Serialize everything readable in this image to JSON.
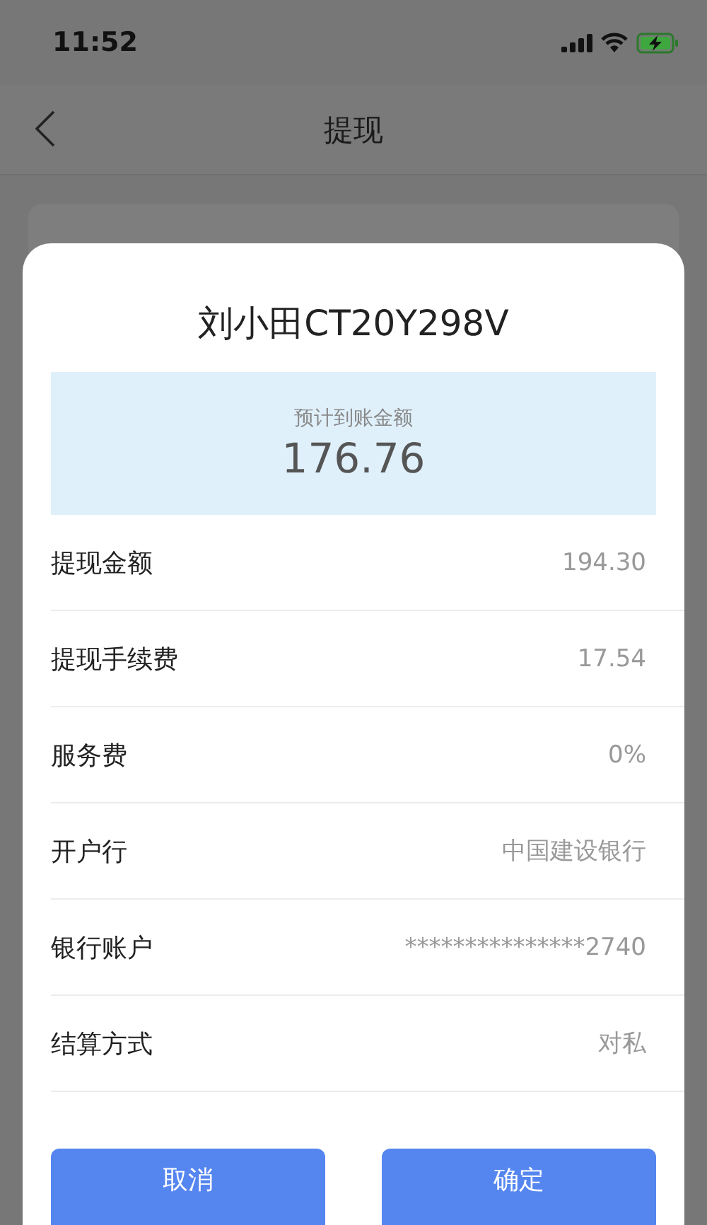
{
  "status_bar": {
    "time": "11:52",
    "battery_charging": true
  },
  "nav_bar": {
    "title": "提现"
  },
  "dialog": {
    "title": "刘小田CT20Y298V",
    "estimate": {
      "label": "预计到账金额",
      "amount": "176.76"
    },
    "rows": [
      {
        "label": "提现金额",
        "value": "194.30"
      },
      {
        "label": "提现手续费",
        "value": "17.54"
      },
      {
        "label": "服务费",
        "value": "0%"
      },
      {
        "label": "开户行",
        "value": "中国建设银行"
      },
      {
        "label": "银行账户",
        "value": "***************2740"
      },
      {
        "label": "结算方式",
        "value": "对私"
      }
    ],
    "buttons": [
      {
        "label": "取消"
      },
      {
        "label": "确定"
      }
    ]
  }
}
